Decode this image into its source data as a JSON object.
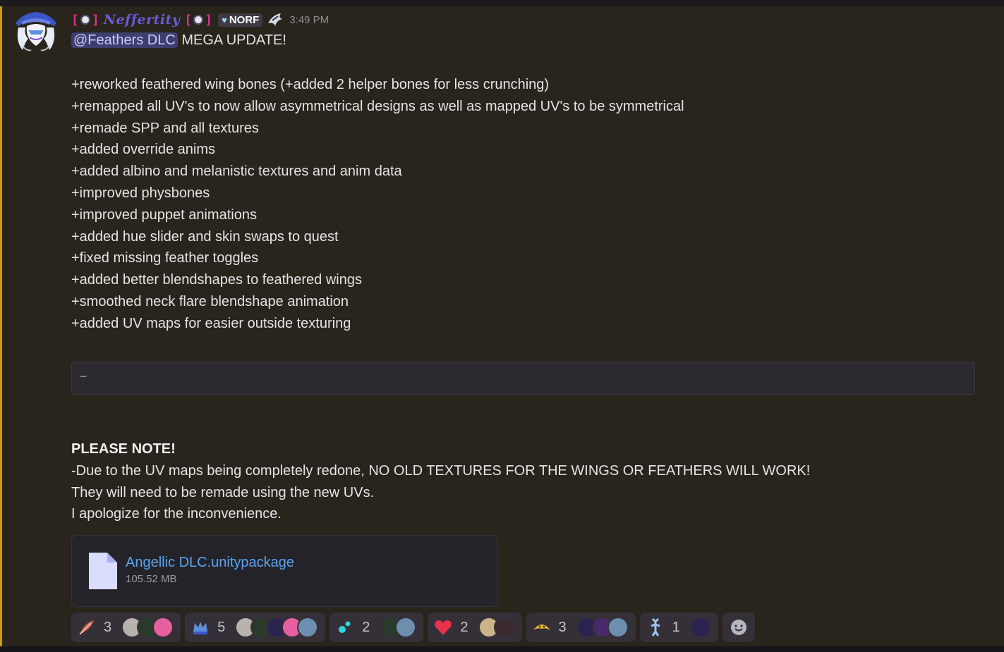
{
  "message": {
    "username": "Neffertity",
    "brackets": [
      "[",
      "]",
      "[",
      "]"
    ],
    "tag": "NORF",
    "timestamp": "3:49 PM",
    "mention": "@Feathers DLC",
    "first_line_rest": " MEGA UPDATE!",
    "changes": [
      "+reworked feathered wing bones (+added 2 helper bones for less crunching)",
      "+remapped all UV's to now allow asymmetrical designs as well as mapped UV's to be symmetrical",
      "+remade SPP and all textures",
      "+added override anims",
      "+added albino and melanistic textures and anim data",
      "+improved physbones",
      "+improved puppet animations",
      "+added hue slider and skin swaps to quest",
      "+fixed missing feather toggles",
      "+added better blendshapes to feathered wings",
      "+smoothed neck flare blendshape animation",
      "+added UV maps for easier outside texturing"
    ],
    "codeblock_text": "–",
    "note_heading": "PLEASE NOTE!",
    "note_lines": [
      "-Due to the UV maps being completely redone, NO OLD TEXTURES FOR THE WINGS OR FEATHERS WILL WORK!",
      "They will need to be remade using the new UVs.",
      "I apologize for the inconvenience."
    ]
  },
  "attachment": {
    "filename": "Angellic DLC.unitypackage",
    "size": "105.52 MB"
  },
  "reactions": [
    {
      "emoji": "feather-emoji",
      "count": "3",
      "faces": 3
    },
    {
      "emoji": "crown-emoji",
      "count": "5",
      "faces": 5
    },
    {
      "emoji": "sparkle-emoji",
      "count": "2",
      "faces": 2
    },
    {
      "emoji": "heart-emoji",
      "count": "2",
      "faces": 2
    },
    {
      "emoji": "shrug-emoji",
      "count": "3",
      "faces": 3
    },
    {
      "emoji": "figure-emoji",
      "count": "1",
      "faces": 1
    }
  ],
  "colors": {
    "mention_bar": "#c89d1a",
    "username": "#6b5bd6",
    "link": "#5aa4f0",
    "message_bg": "#29241c"
  }
}
